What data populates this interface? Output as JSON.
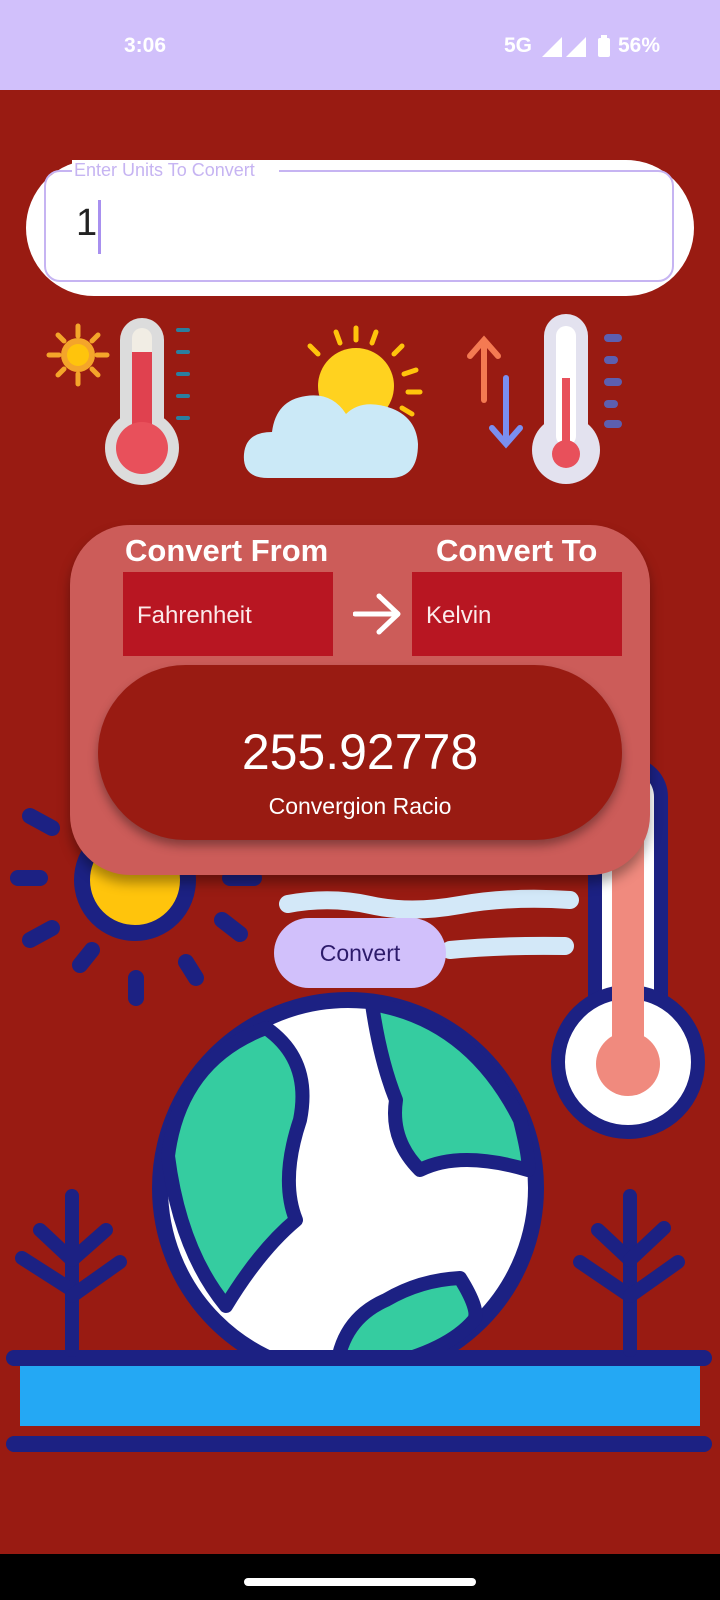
{
  "status_bar": {
    "time": "3:06",
    "network": "5G",
    "battery": "56%"
  },
  "input": {
    "label": "Enter Units To Convert",
    "value": "1"
  },
  "icons": [
    "sun-icon",
    "thermometer-icon",
    "cloud-sun-icon",
    "temperature-change-icon"
  ],
  "converter": {
    "from_heading": "Convert From",
    "to_heading": "Convert To",
    "from_unit": "Fahrenheit",
    "to_unit": "Kelvin",
    "result": "255.92778",
    "result_caption": "Convergion Racio"
  },
  "convert_button": "Convert",
  "colors": {
    "background": "#991b12",
    "status_bar": "#d1c0fb",
    "card": "#cc5c59",
    "select": "#b81622",
    "accent": "#d1c0fb"
  }
}
